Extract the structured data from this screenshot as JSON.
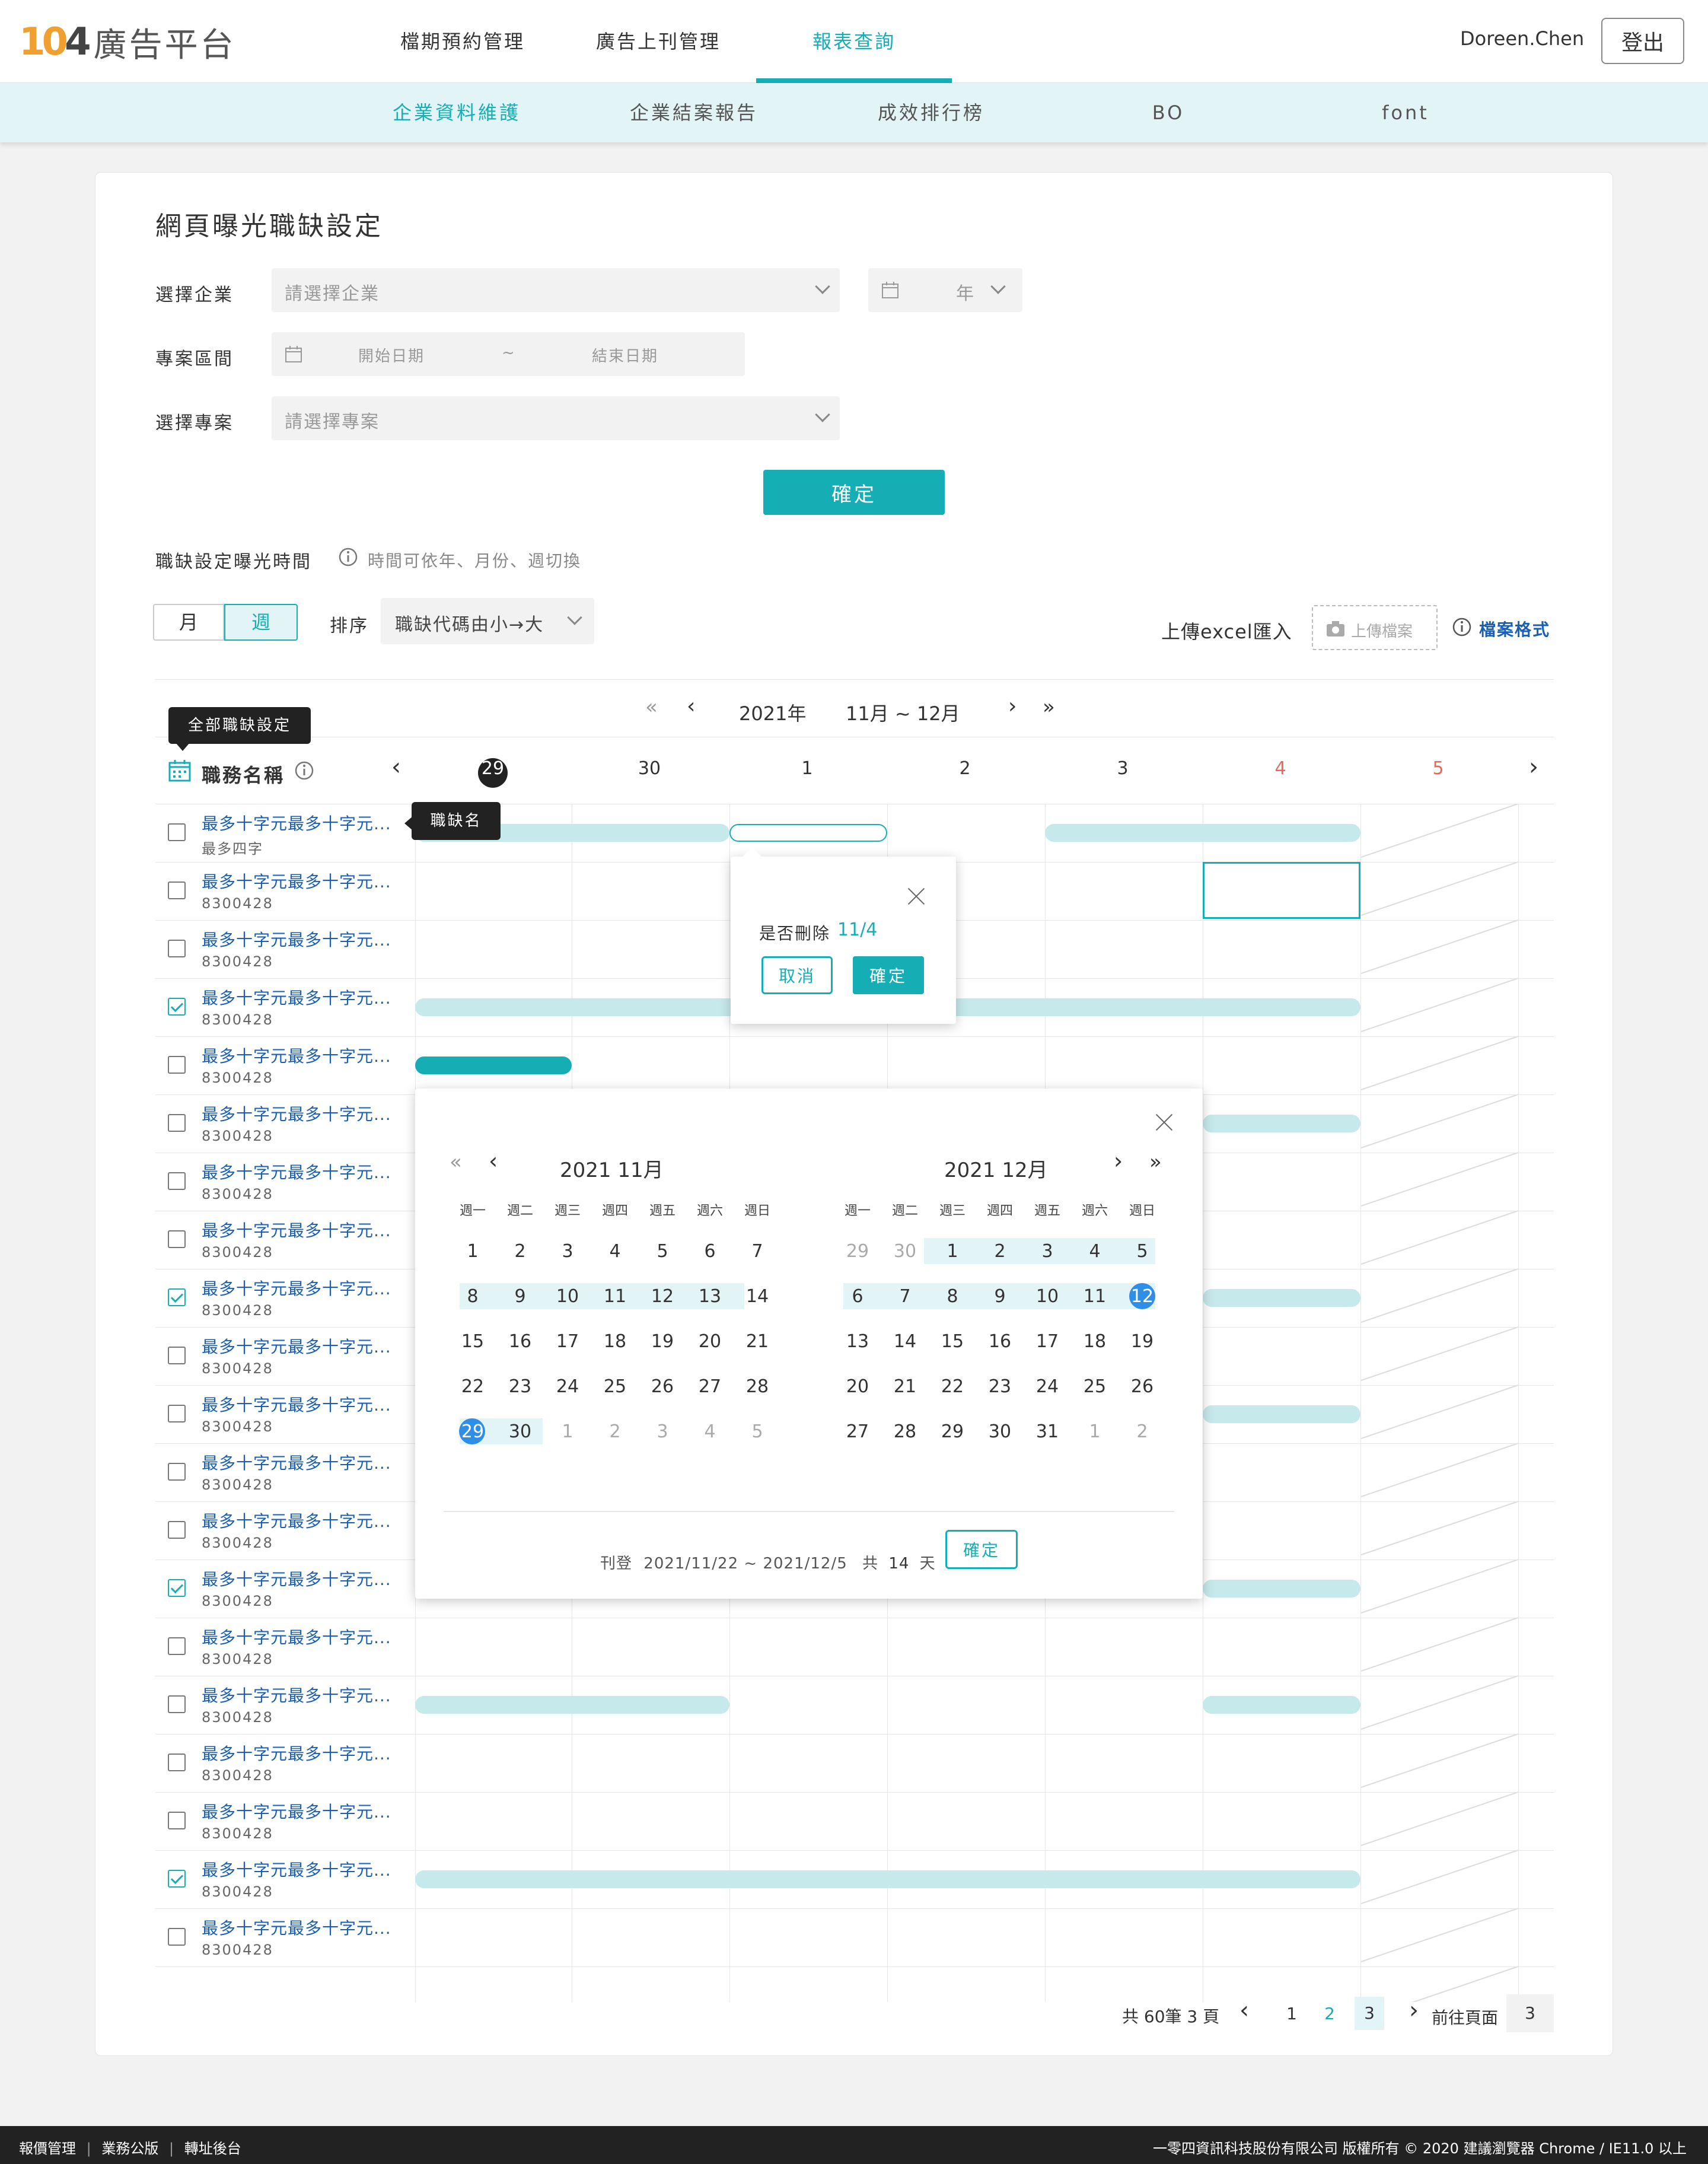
{
  "header": {
    "logo_num": "104",
    "logo_text": "廣告平台",
    "nav": [
      "檔期預約管理",
      "廣告上刊管理",
      "報表查詢"
    ],
    "user": "Doreen.Chen",
    "logout": "登出"
  },
  "subnav": [
    "企業資料維護",
    "企業結案報告",
    "成效排行榜",
    "BO",
    "font"
  ],
  "page": {
    "title": "網頁曝光職缺設定",
    "company_label": "選擇企業",
    "company_placeholder": "請選擇企業",
    "year_label": "年",
    "period_label": "專案區間",
    "start_placeholder": "開始日期",
    "tilde": "~",
    "end_placeholder": "結束日期",
    "project_label": "選擇專案",
    "project_placeholder": "請選擇專案",
    "confirm": "確定"
  },
  "exposure": {
    "label": "職缺設定曝光時間",
    "hint": "時間可依年、月份、週切換",
    "tab_month": "月",
    "tab_week": "週",
    "sort_label": "排序",
    "sort_value": "職缺代碼由小→大",
    "upload_label": "上傳excel匯入",
    "upload_button": "上傳檔案",
    "format_link": "檔案格式"
  },
  "schedule": {
    "year": "2021年",
    "range": "11月 ~ 12月",
    "all_tooltip": "全部職缺設定",
    "job_col": "職務名稱",
    "days": [
      "29",
      "30",
      "1",
      "2",
      "3",
      "4",
      "5"
    ],
    "name_tooltip": "職缺名",
    "rows": [
      {
        "title": "最多十字元最多十字元...",
        "code": "最多四字",
        "checked": false
      },
      {
        "title": "最多十字元最多十字元...",
        "code": "8300428",
        "checked": false
      },
      {
        "title": "最多十字元最多十字元...",
        "code": "8300428",
        "checked": false
      },
      {
        "title": "最多十字元最多十字元...",
        "code": "8300428",
        "checked": true
      },
      {
        "title": "最多十字元最多十字元...",
        "code": "8300428",
        "checked": false
      },
      {
        "title": "最多十字元最多十字元...",
        "code": "8300428",
        "checked": false
      },
      {
        "title": "最多十字元最多十字元...",
        "code": "8300428",
        "checked": false
      },
      {
        "title": "最多十字元最多十字元...",
        "code": "8300428",
        "checked": false
      },
      {
        "title": "最多十字元最多十字元...",
        "code": "8300428",
        "checked": true
      },
      {
        "title": "最多十字元最多十字元...",
        "code": "8300428",
        "checked": false
      },
      {
        "title": "最多十字元最多十字元...",
        "code": "8300428",
        "checked": false
      },
      {
        "title": "最多十字元最多十字元...",
        "code": "8300428",
        "checked": false
      },
      {
        "title": "最多十字元最多十字元...",
        "code": "8300428",
        "checked": false
      },
      {
        "title": "最多十字元最多十字元...",
        "code": "8300428",
        "checked": true
      },
      {
        "title": "最多十字元最多十字元...",
        "code": "8300428",
        "checked": false
      },
      {
        "title": "最多十字元最多十字元...",
        "code": "8300428",
        "checked": false
      },
      {
        "title": "最多十字元最多十字元...",
        "code": "8300428",
        "checked": false
      },
      {
        "title": "最多十字元最多十字元...",
        "code": "8300428",
        "checked": false
      },
      {
        "title": "最多十字元最多十字元...",
        "code": "8300428",
        "checked": true
      },
      {
        "title": "最多十字元最多十字元...",
        "code": "8300428",
        "checked": false
      }
    ]
  },
  "delete_popup": {
    "question": "是否刪除",
    "date": "11/4",
    "cancel": "取消",
    "confirm": "確定"
  },
  "calendar": {
    "left_title": "2021  11月",
    "right_title": "2021  12月",
    "weekdays": [
      "週一",
      "週二",
      "週三",
      "週四",
      "週五",
      "週六",
      "週日"
    ],
    "left_days": [
      [
        "1",
        "2",
        "3",
        "4",
        "5",
        "6",
        "7"
      ],
      [
        "8",
        "9",
        "10",
        "11",
        "12",
        "13",
        "14"
      ],
      [
        "15",
        "16",
        "17",
        "18",
        "19",
        "20",
        "21"
      ],
      [
        "22",
        "23",
        "24",
        "25",
        "26",
        "27",
        "28"
      ],
      [
        "29",
        "30",
        "1",
        "2",
        "3",
        "4",
        "5"
      ]
    ],
    "right_days": [
      [
        "29",
        "30",
        "1",
        "2",
        "3",
        "4",
        "5"
      ],
      [
        "6",
        "7",
        "8",
        "9",
        "10",
        "11",
        "12"
      ],
      [
        "13",
        "14",
        "15",
        "16",
        "17",
        "18",
        "19"
      ],
      [
        "20",
        "21",
        "22",
        "23",
        "24",
        "25",
        "26"
      ],
      [
        "27",
        "28",
        "29",
        "30",
        "31",
        "1",
        "2"
      ]
    ],
    "footer_label": "刊登",
    "footer_range": "2021/11/22 ~ 2021/12/5",
    "footer_total": "共",
    "footer_days": "14",
    "footer_unit": "天",
    "confirm": "確定"
  },
  "pagination": {
    "summary": "共 60筆 3 頁",
    "pages": [
      "1",
      "2",
      "3"
    ],
    "goto_label": "前往頁面",
    "goto_value": "3"
  },
  "footer": {
    "links": [
      "報價管理",
      "業務公版",
      "轉址後台"
    ],
    "copyright": "一零四資訊科技股份有限公司 版權所有 © 2020  建議瀏覽器 Chrome / IE11.0 以上"
  },
  "colors": {
    "accent": "#16aeb5",
    "blue_link": "#1a5fb4",
    "weekend": "#e8685a",
    "selected_day": "#2f8fe8"
  }
}
